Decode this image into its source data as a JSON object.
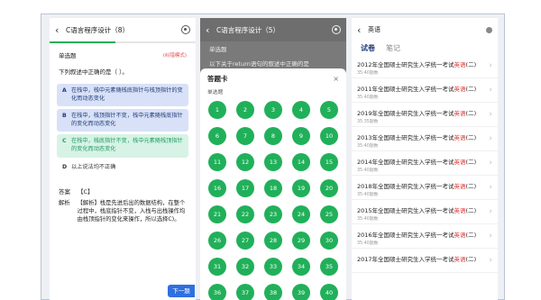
{
  "panel1": {
    "title": "C语言程序设计（8）",
    "progress": 0.45,
    "qtype": "单选题",
    "feedback": "(纠错模式)",
    "stem": "下列叙述中正确的是（ ）。",
    "options": [
      {
        "letter": "A",
        "text": "在栈中，栈中元素随栈底指针与栈顶指针的变化而动态变化"
      },
      {
        "letter": "B",
        "text": "在栈中，栈顶指针不变，栈中元素随栈底指针的变化而动态变化"
      },
      {
        "letter": "C",
        "text": "在栈中，栈底指针不变，栈中元素随栈顶指针的变化而动态变化"
      },
      {
        "letter": "D",
        "text": "以上说法均不正确"
      }
    ],
    "answer_label": "答案",
    "answer_value": "【C】",
    "explain_label": "解析",
    "explain_text": "【解析】栈是先进后出的数据结构，在整个过程中，栈底指针不变，入栈与出栈操作均由栈顶指针的变化来操作，所以选择C)。",
    "next_label": "下一题"
  },
  "panel2": {
    "title": "C语言程序设计（5）",
    "qtype": "单选题",
    "stem": "以下关于return语句的叙述中正确的是",
    "sheet_title": "答题卡",
    "sheet_close": "×",
    "sheet_sub": "单选题",
    "numbers": [
      "1",
      "2",
      "3",
      "4",
      "5",
      "6",
      "7",
      "8",
      "9",
      "10",
      "11",
      "12",
      "13",
      "14",
      "15",
      "16",
      "17",
      "18",
      "19",
      "20",
      "21",
      "22",
      "23",
      "24",
      "25",
      "26",
      "27",
      "28",
      "29",
      "30",
      "31",
      "32",
      "33",
      "34",
      "35",
      "36",
      "37",
      "38",
      "39",
      "40"
    ]
  },
  "panel3": {
    "title": "英语",
    "tabs": [
      "试卷",
      "笔记"
    ],
    "items": [
      {
        "pre": "2012年全国硕士研究生入学统一考试",
        "hl": "英语",
        "post": "(二)",
        "sub": "35:40题数"
      },
      {
        "pre": "2011年全国硕士研究生入学统一考试",
        "hl": "英语",
        "post": "(二)",
        "sub": "35:40题数"
      },
      {
        "pre": "2019年全国硕士研究生入学统一考试",
        "hl": "英语",
        "post": "(二)",
        "sub": "35:35题数"
      },
      {
        "pre": "2013年全国硕士研究生入学统一考试",
        "hl": "英语",
        "post": "(二)",
        "sub": "35:40题数"
      },
      {
        "pre": "2014年全国硕士研究生入学统一考试",
        "hl": "英语",
        "post": "(二)",
        "sub": "35:40题数"
      },
      {
        "pre": "2018年全国硕士研究生入学统一考试",
        "hl": "英语",
        "post": "(二)",
        "sub": "35:40题数"
      },
      {
        "pre": "2015年全国硕士研究生入学统一考试",
        "hl": "英语",
        "post": "(二)",
        "sub": "35:40题数"
      },
      {
        "pre": "2016年全国硕士研究生入学统一考试",
        "hl": "英语",
        "post": "(二)",
        "sub": "35:40题数"
      },
      {
        "pre": "2017年全国硕士研究生入学统一考试",
        "hl": "英语",
        "post": "(二)",
        "sub": ""
      }
    ]
  },
  "colors": {
    "accent_green": "#21b05a",
    "accent_blue": "#2f6fe0",
    "highlight_red": "#e03030"
  }
}
